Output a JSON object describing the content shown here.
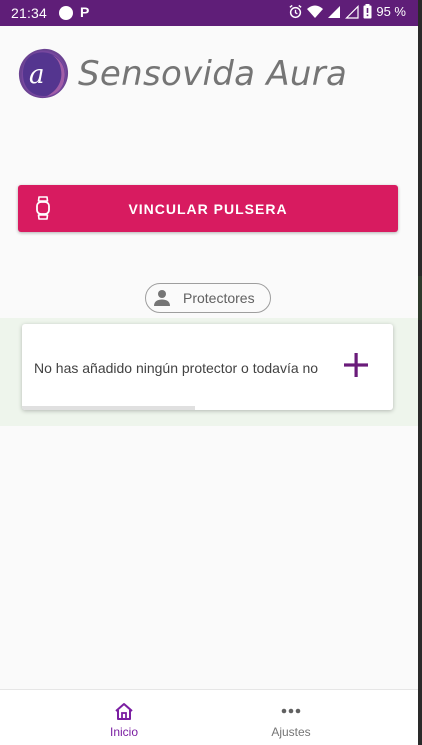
{
  "status_bar": {
    "time": "21:34",
    "app_letter": "P",
    "battery": "95 %",
    "icons": [
      "alarm-icon",
      "wifi-icon",
      "signal-icon",
      "signal-empty-icon",
      "battery-icon"
    ]
  },
  "header": {
    "logo_text": "Sensovida Aura",
    "logo_letter": "a"
  },
  "link_button": {
    "label": "VINCULAR PULSERA",
    "icon": "watch-icon"
  },
  "protectors_chip": {
    "label": "Protectores",
    "icon": "person-icon"
  },
  "protectors_card": {
    "message": "No has añadido ningún protector o todavía no",
    "add_icon": "plus-icon"
  },
  "bottom_nav": {
    "items": [
      {
        "label": "Inicio",
        "icon": "home-icon",
        "active": true
      },
      {
        "label": "Ajustes",
        "icon": "more-icon",
        "active": false
      }
    ]
  },
  "colors": {
    "status_bar": "#5f1e78",
    "primary_button": "#d81b60",
    "accent_purple": "#6a1b7a",
    "nav_active": "#7b1fa2"
  }
}
